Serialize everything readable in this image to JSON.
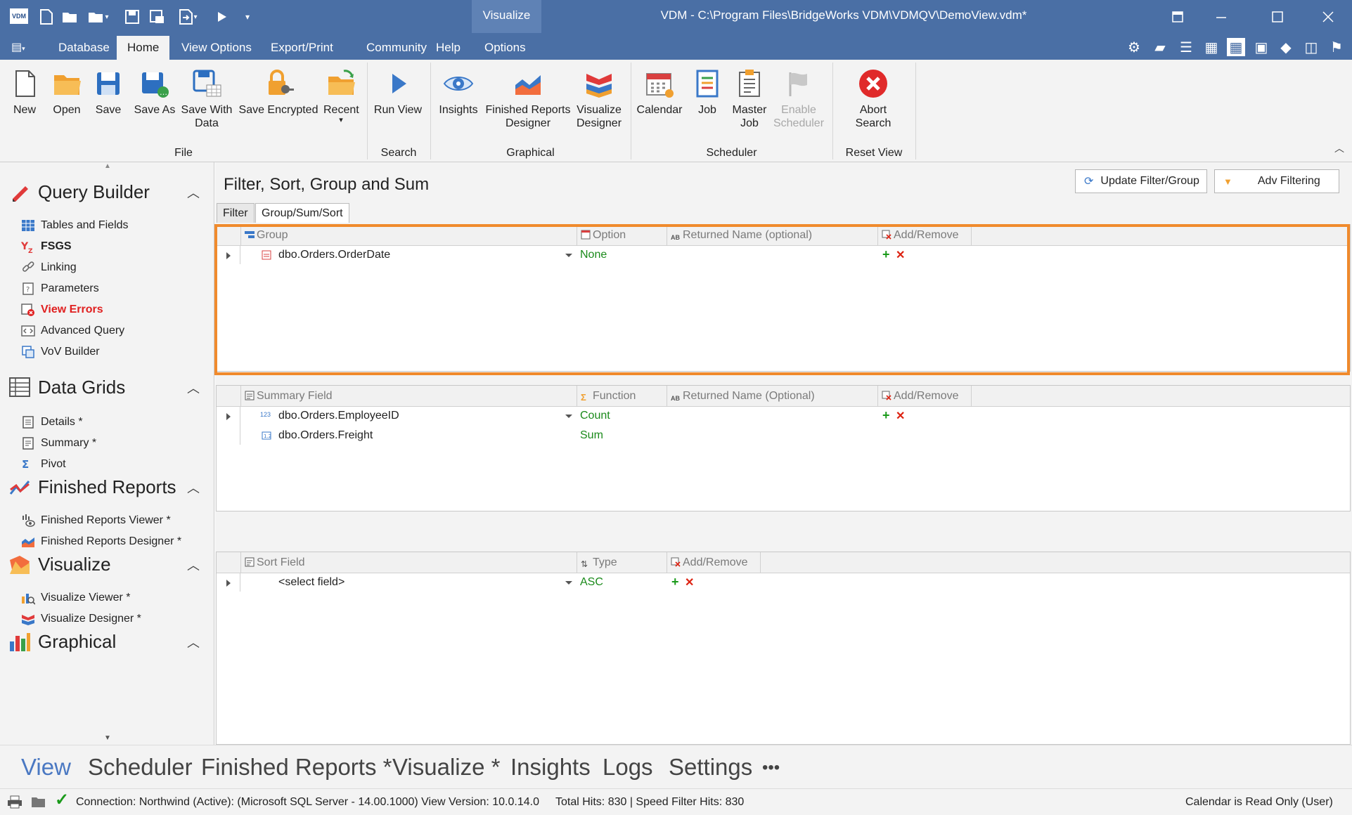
{
  "app": {
    "title": "VDM - C:\\Program Files\\BridgeWorks VDM\\VDMQV\\DemoView.vdm*",
    "logo": "VDM",
    "context_tab": "Visualize"
  },
  "menu_tabs": [
    "Database",
    "Home",
    "View Options",
    "Export/Print",
    "Community",
    "Help",
    "Options"
  ],
  "ribbon": {
    "groups": {
      "file": "File",
      "search": "Search",
      "graphical": "Graphical",
      "scheduler": "Scheduler",
      "reset_view": "Reset View"
    },
    "buttons": {
      "new": "New",
      "open": "Open",
      "save": "Save",
      "save_as": "Save As",
      "save_with_data_1": "Save With",
      "save_with_data_2": "Data",
      "save_encrypted": "Save Encrypted",
      "recent": "Recent",
      "run_view": "Run View",
      "insights": "Insights",
      "finished_reports_designer_1": "Finished Reports",
      "finished_reports_designer_2": "Designer",
      "visualize_designer_1": "Visualize",
      "visualize_designer_2": "Designer",
      "calendar": "Calendar",
      "job": "Job",
      "master_job_1": "Master",
      "master_job_2": "Job",
      "enable_scheduler_1": "Enable",
      "enable_scheduler_2": "Scheduler",
      "abort_search_1": "Abort",
      "abort_search_2": "Search"
    }
  },
  "nav": {
    "query_builder": {
      "title": "Query Builder",
      "items": [
        "Tables and Fields",
        "FSGS",
        "Linking",
        "Parameters",
        "View Errors",
        "Advanced Query",
        "VoV Builder"
      ]
    },
    "data_grids": {
      "title": "Data Grids",
      "items": [
        "Details *",
        "Summary *",
        "Pivot"
      ]
    },
    "finished_reports": {
      "title": "Finished Reports",
      "items": [
        "Finished Reports Viewer *",
        "Finished Reports Designer *"
      ]
    },
    "visualize": {
      "title": "Visualize",
      "items": [
        "Visualize Viewer *",
        "Visualize Designer *"
      ]
    },
    "graphical": {
      "title": "Graphical"
    }
  },
  "main": {
    "title": "Filter, Sort, Group and Sum",
    "update_button": "Update Filter/Group",
    "adv_filter_button": "Adv Filtering",
    "tabs": [
      "Filter",
      "Group/Sum/Sort"
    ],
    "group_grid": {
      "headers": [
        "Group",
        "Option",
        "Returned Name (optional)",
        "Add/Remove"
      ],
      "rows": [
        {
          "field": "dbo.Orders.OrderDate",
          "option": "None"
        }
      ]
    },
    "summary_grid": {
      "headers": [
        "Summary Field",
        "Function",
        "Returned Name (Optional)",
        "Add/Remove"
      ],
      "rows": [
        {
          "field": "dbo.Orders.EmployeeID",
          "function": "Count"
        },
        {
          "field": "dbo.Orders.Freight",
          "function": "Sum"
        }
      ]
    },
    "sort_grid": {
      "headers": [
        "Sort Field",
        "Type",
        "Add/Remove"
      ],
      "rows": [
        {
          "field": "<select field>",
          "type": "ASC"
        }
      ]
    }
  },
  "bottom_nav": [
    "View",
    "Scheduler",
    "Finished Reports *",
    "Visualize *",
    "Insights",
    "Logs",
    "Settings",
    "•••"
  ],
  "status": {
    "connection": "Connection: Northwind (Active): (Microsoft SQL Server - 14.00.1000) View Version: 10.0.14.0",
    "hits": "Total Hits: 830 | Speed Filter Hits: 830",
    "calendar": "Calendar is Read Only (User)"
  },
  "colors": {
    "title_bar": "#4a6fa5",
    "highlight": "#f08a2c",
    "accent_blue": "#4a78c2",
    "green_text": "#1a8a1a"
  }
}
